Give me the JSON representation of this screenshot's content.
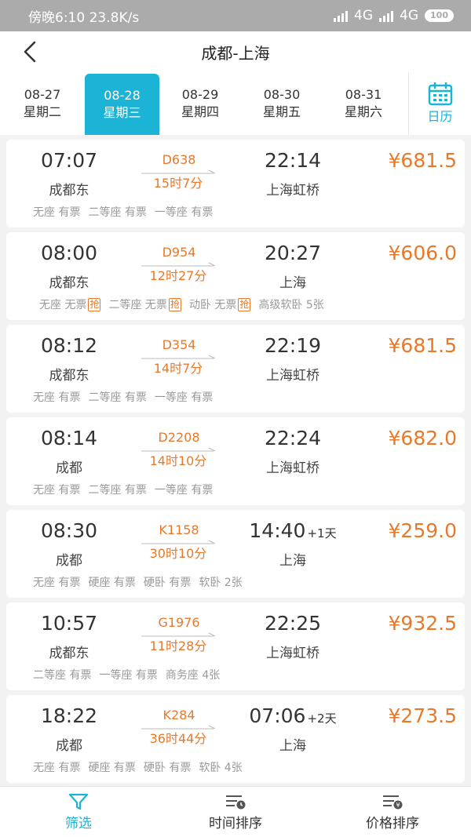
{
  "status_bar": {
    "time_text": "傍晚6:10",
    "speed": "23.8K/s",
    "network_1": "4G",
    "network_2": "4G",
    "battery": "100"
  },
  "header": {
    "title": "成都-上海",
    "back_icon": "chevron-left-icon"
  },
  "date_tabs": [
    {
      "date": "08-27",
      "weekday": "星期二",
      "active": false
    },
    {
      "date": "08-28",
      "weekday": "星期三",
      "active": true
    },
    {
      "date": "08-29",
      "weekday": "星期四",
      "active": false
    },
    {
      "date": "08-30",
      "weekday": "星期五",
      "active": false
    },
    {
      "date": "08-31",
      "weekday": "星期六",
      "active": false
    }
  ],
  "calendar": {
    "label": "日历",
    "icon": "calendar-icon"
  },
  "trains": [
    {
      "dep_time": "07:07",
      "dep_station": "成都东",
      "train_no": "D638",
      "duration": "15时7分",
      "arr_time": "22:14",
      "day_offset": "",
      "arr_station": "上海虹桥",
      "price": "¥681.5",
      "seats": [
        {
          "text": "无座 有票",
          "grab": ""
        },
        {
          "text": "二等座 有票",
          "grab": ""
        },
        {
          "text": "一等座 有票",
          "grab": ""
        }
      ]
    },
    {
      "dep_time": "08:00",
      "dep_station": "成都东",
      "train_no": "D954",
      "duration": "12时27分",
      "arr_time": "20:27",
      "day_offset": "",
      "arr_station": "上海",
      "price": "¥606.0",
      "seats": [
        {
          "text": "无座 无票",
          "grab": "抢"
        },
        {
          "text": "二等座 无票",
          "grab": "抢"
        },
        {
          "text": "动卧 无票",
          "grab": "抢"
        },
        {
          "text": "高级软卧 5张",
          "grab": ""
        }
      ]
    },
    {
      "dep_time": "08:12",
      "dep_station": "成都东",
      "train_no": "D354",
      "duration": "14时7分",
      "arr_time": "22:19",
      "day_offset": "",
      "arr_station": "上海虹桥",
      "price": "¥681.5",
      "seats": [
        {
          "text": "无座 有票",
          "grab": ""
        },
        {
          "text": "二等座 有票",
          "grab": ""
        },
        {
          "text": "一等座 有票",
          "grab": ""
        }
      ]
    },
    {
      "dep_time": "08:14",
      "dep_station": "成都",
      "train_no": "D2208",
      "duration": "14时10分",
      "arr_time": "22:24",
      "day_offset": "",
      "arr_station": "上海虹桥",
      "price": "¥682.0",
      "seats": [
        {
          "text": "无座 有票",
          "grab": ""
        },
        {
          "text": "二等座 有票",
          "grab": ""
        },
        {
          "text": "一等座 有票",
          "grab": ""
        }
      ]
    },
    {
      "dep_time": "08:30",
      "dep_station": "成都",
      "train_no": "K1158",
      "duration": "30时10分",
      "arr_time": "14:40",
      "day_offset": "+1天",
      "arr_station": "上海",
      "price": "¥259.0",
      "seats": [
        {
          "text": "无座 有票",
          "grab": ""
        },
        {
          "text": "硬座 有票",
          "grab": ""
        },
        {
          "text": "硬卧 有票",
          "grab": ""
        },
        {
          "text": "软卧 2张",
          "grab": ""
        }
      ]
    },
    {
      "dep_time": "10:57",
      "dep_station": "成都东",
      "train_no": "G1976",
      "duration": "11时28分",
      "arr_time": "22:25",
      "day_offset": "",
      "arr_station": "上海虹桥",
      "price": "¥932.5",
      "seats": [
        {
          "text": "二等座 有票",
          "grab": ""
        },
        {
          "text": "一等座 有票",
          "grab": ""
        },
        {
          "text": "商务座 4张",
          "grab": ""
        }
      ]
    },
    {
      "dep_time": "18:22",
      "dep_station": "成都",
      "train_no": "K284",
      "duration": "36时44分",
      "arr_time": "07:06",
      "day_offset": "+2天",
      "arr_station": "上海",
      "price": "¥273.5",
      "seats": [
        {
          "text": "无座 有票",
          "grab": ""
        },
        {
          "text": "硬座 有票",
          "grab": ""
        },
        {
          "text": "硬卧 有票",
          "grab": ""
        },
        {
          "text": "软卧 4张",
          "grab": ""
        }
      ]
    }
  ],
  "bottom_bar": [
    {
      "label": "筛选",
      "icon": "filter-icon",
      "active": true
    },
    {
      "label": "时间排序",
      "icon": "sort-time-icon",
      "active": false
    },
    {
      "label": "价格排序",
      "icon": "sort-price-icon",
      "active": false
    }
  ],
  "colors": {
    "accent": "#1bb3d6",
    "price": "#e8792b",
    "muted": "#999999"
  }
}
